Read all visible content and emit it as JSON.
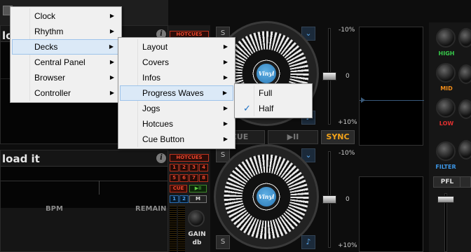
{
  "menus": {
    "main": [
      {
        "label": "Clock",
        "has_submenu": true
      },
      {
        "label": "Rhythm",
        "has_submenu": true
      },
      {
        "label": "Decks",
        "has_submenu": true,
        "highlighted": true
      },
      {
        "label": "Central Panel",
        "has_submenu": true
      },
      {
        "label": "Browser",
        "has_submenu": true
      },
      {
        "label": "Controller",
        "has_submenu": true
      }
    ],
    "decks": [
      {
        "label": "Layout",
        "has_submenu": true
      },
      {
        "label": "Covers",
        "has_submenu": true
      },
      {
        "label": "Infos",
        "has_submenu": true
      },
      {
        "label": "Progress Waves",
        "has_submenu": true,
        "highlighted": true
      },
      {
        "label": "Jogs",
        "has_submenu": true
      },
      {
        "label": "Hotcues",
        "has_submenu": true
      },
      {
        "label": "Cue Button",
        "has_submenu": true
      }
    ],
    "progress_waves": [
      {
        "label": "Full",
        "checked": false
      },
      {
        "label": "Half",
        "checked": true
      }
    ],
    "arrow_glyph": "▶",
    "check_glyph": "✓"
  },
  "deck_top": {
    "title": "lo",
    "info_icon": "i",
    "hotcues_label": "HOTCUES"
  },
  "deck_bottom": {
    "title": "load it",
    "info_icon": "i",
    "bpm_label": "BPM",
    "remain_label": "REMAIN"
  },
  "hotcues": {
    "header": "HOTCUES",
    "buttons": [
      "1",
      "2",
      "3",
      "4",
      "5",
      "6",
      "7",
      "8"
    ],
    "cue_label": "CUE",
    "play_label": "▶II",
    "loop": [
      "1",
      "2"
    ],
    "m_label": "M",
    "gain_label": "GAIN",
    "gain_unit": "db"
  },
  "jog_center_label": "Vinyl",
  "pitch": {
    "top": "-10%",
    "mid": "0",
    "bottom": "+10%",
    "top2": "-10%",
    "mid2": "0",
    "bottom2": "+10%"
  },
  "transport": {
    "cue": "CUE",
    "play": "▶II",
    "sync": "SYNC"
  },
  "buttons": {
    "s": "S",
    "down": "⌄",
    "note": "♪"
  },
  "mixer": {
    "high": "HIGH",
    "mid": "MID",
    "low": "LOW",
    "filter": "FILTER",
    "pfl": "PFL"
  },
  "colors": {
    "menu_bg": "#f0f0f0",
    "highlight": "#dbe9f7",
    "hotcue_red": "#e8452c",
    "sync_orange": "#f2a21a",
    "high_green": "#37c94a",
    "mid_orange": "#f08c1a",
    "low_red": "#e03030",
    "filter_blue": "#3c96e6"
  }
}
